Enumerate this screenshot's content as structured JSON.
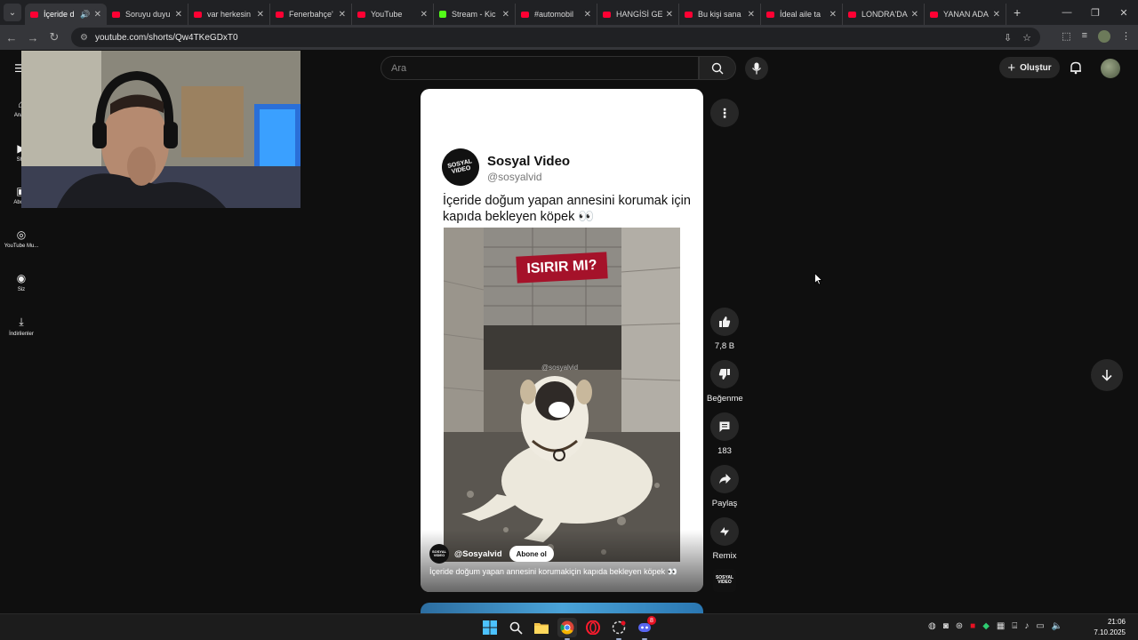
{
  "browser": {
    "tabs": [
      {
        "title": "İçeride d",
        "active": true,
        "favicon": "youtube-icon"
      },
      {
        "title": "Soruyu duyu",
        "favicon": "youtube-icon"
      },
      {
        "title": "var herkesin",
        "favicon": "youtube-icon"
      },
      {
        "title": "Fenerbahçe'",
        "favicon": "youtube-icon"
      },
      {
        "title": "YouTube",
        "favicon": "youtube-icon"
      },
      {
        "title": "Stream - Kic",
        "favicon": "kick-icon"
      },
      {
        "title": "#automobil",
        "favicon": "youtube-icon"
      },
      {
        "title": "HANGİSİ GE",
        "favicon": "youtube-icon"
      },
      {
        "title": "Bu kişi sana",
        "favicon": "youtube-icon"
      },
      {
        "title": "İdeal aile ta",
        "favicon": "youtube-icon"
      },
      {
        "title": "LONDRA'DA",
        "favicon": "youtube-icon"
      },
      {
        "title": "YANAN ADA",
        "favicon": "youtube-icon"
      }
    ],
    "url": "youtube.com/shorts/Qw4TKeGDxT0"
  },
  "sidebar": {
    "items": [
      {
        "label": "Ana S",
        "icon": "home-icon"
      },
      {
        "label": "Sho",
        "icon": "shorts-icon"
      },
      {
        "label": "Abone",
        "icon": "subscriptions-icon"
      },
      {
        "label": "YouTube Mu...",
        "icon": "youtube-music-icon"
      },
      {
        "label": "Siz",
        "icon": "profile-icon"
      },
      {
        "label": "İndirilenler",
        "icon": "download-icon"
      }
    ]
  },
  "header": {
    "search_placeholder": "Ara",
    "create_label": "Oluştur"
  },
  "short": {
    "post_channel_name": "Sosyal Video",
    "post_handle": "@sosyalvid",
    "post_caption": "İçeride doğum yapan annesini korumak için kapıda bekleyen köpek 👀",
    "overlay_text": "ISIRIR MI?",
    "watermark": "@sosyalvid",
    "channel_handle": "@Sosyalvid",
    "subscribe_label": "Abone ol",
    "title": "İçeride doğum yapan annesini korumakiçin kapıda bekleyen köpek 👀",
    "logo_text": "SOSYAL VIDEO"
  },
  "actions": {
    "like_count": "7,8 B",
    "dislike_label": "Beğenme",
    "comment_count": "183",
    "share_label": "Paylaş",
    "remix_label": "Remix"
  },
  "taskbar": {
    "time": "21:06",
    "date": "7.10.2025",
    "discord_badge": "8"
  },
  "colors": {
    "youtube_red": "#ff0033",
    "kick_green": "#53fc18",
    "overlay_red": "#a5122a"
  }
}
